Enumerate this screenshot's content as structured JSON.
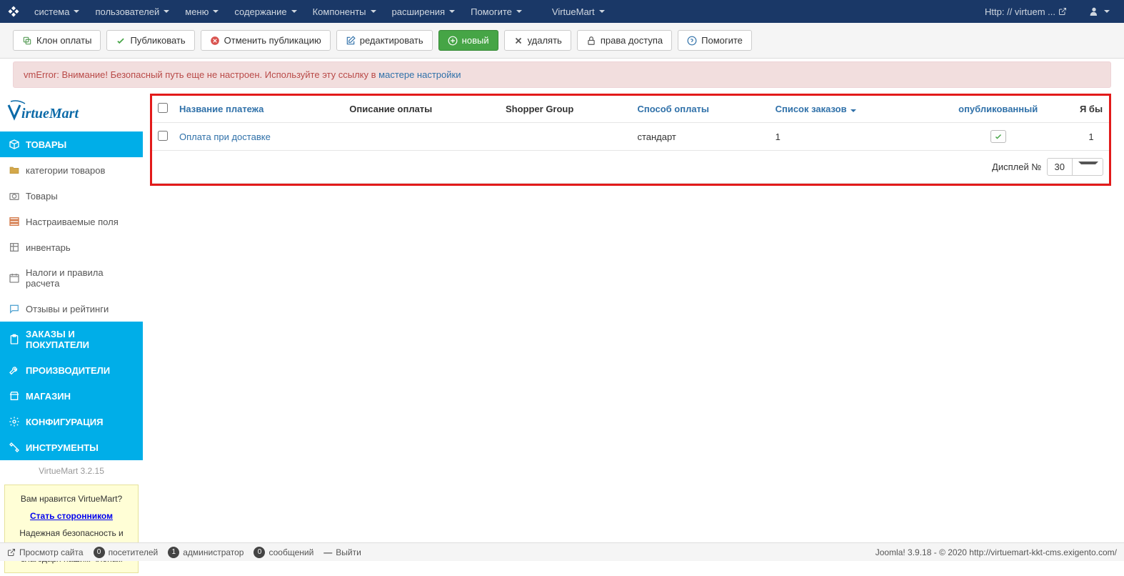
{
  "topnav": {
    "items": [
      "система",
      "пользователей",
      "меню",
      "содержание",
      "Компоненты",
      "расширения",
      "Помогите"
    ],
    "virtuemart": "VirtueMart",
    "site_link": "Http: // virtuem ..."
  },
  "toolbar": {
    "clone": "Клон оплаты",
    "publish": "Публиковать",
    "unpublish": "Отменить публикацию",
    "edit": "редактировать",
    "new": "новый",
    "delete": "удалять",
    "permissions": "права доступа",
    "help": "Помогите"
  },
  "alert": {
    "prefix": "vmError: Внимание! Безопасный путь еще не настроен. Используйте эту ссылку в ",
    "link": "мастере настройки"
  },
  "sidebar": {
    "logo_v": "V",
    "logo_rest": "irtueMart",
    "groups": [
      {
        "label": "ТОВАРЫ",
        "header": true
      },
      {
        "label": "категории товаров"
      },
      {
        "label": "Товары"
      },
      {
        "label": "Настраиваемые поля"
      },
      {
        "label": "инвентарь"
      },
      {
        "label": "Налоги и правила расчета"
      },
      {
        "label": "Отзывы и рейтинги"
      },
      {
        "label": "ЗАКАЗЫ И ПОКУПАТЕЛИ",
        "header": true
      },
      {
        "label": "ПРОИЗВОДИТЕЛИ",
        "header": true
      },
      {
        "label": "МАГАЗИН",
        "header": true
      },
      {
        "label": "КОНФИГУРАЦИЯ",
        "header": true
      },
      {
        "label": "ИНСТРУМЕНТЫ",
        "header": true
      }
    ],
    "version": "VirtueMart 3.2.15",
    "promo": {
      "q": "Вам нравится VirtueMart?",
      "cta": "Стать сторонником",
      "desc": "Надежная безопасность и передовое развитие благодаря нашим членам"
    }
  },
  "table": {
    "headers": {
      "name": "Название платежа",
      "desc": "Описание оплаты",
      "shopper": "Shopper Group",
      "method": "Способ оплаты",
      "list": "Список заказов",
      "published": "опубликованный",
      "id": "Я бы"
    },
    "rows": [
      {
        "name": "Оплата при доставке",
        "desc": "",
        "shopper": "",
        "method": "стандарт",
        "list": "1",
        "published": true,
        "id": "1"
      }
    ],
    "display_label": "Дисплей №",
    "display_value": "30"
  },
  "footer": {
    "view_site": "Просмотр сайта",
    "visitors": {
      "count": "0",
      "label": "посетителей"
    },
    "admins": {
      "count": "1",
      "label": "администратор"
    },
    "messages": {
      "count": "0",
      "label": "сообщений"
    },
    "logout": "Выйти",
    "copyright": "Joomla! 3.9.18 - © 2020 http://virtuemart-kkt-cms.exigento.com/"
  }
}
